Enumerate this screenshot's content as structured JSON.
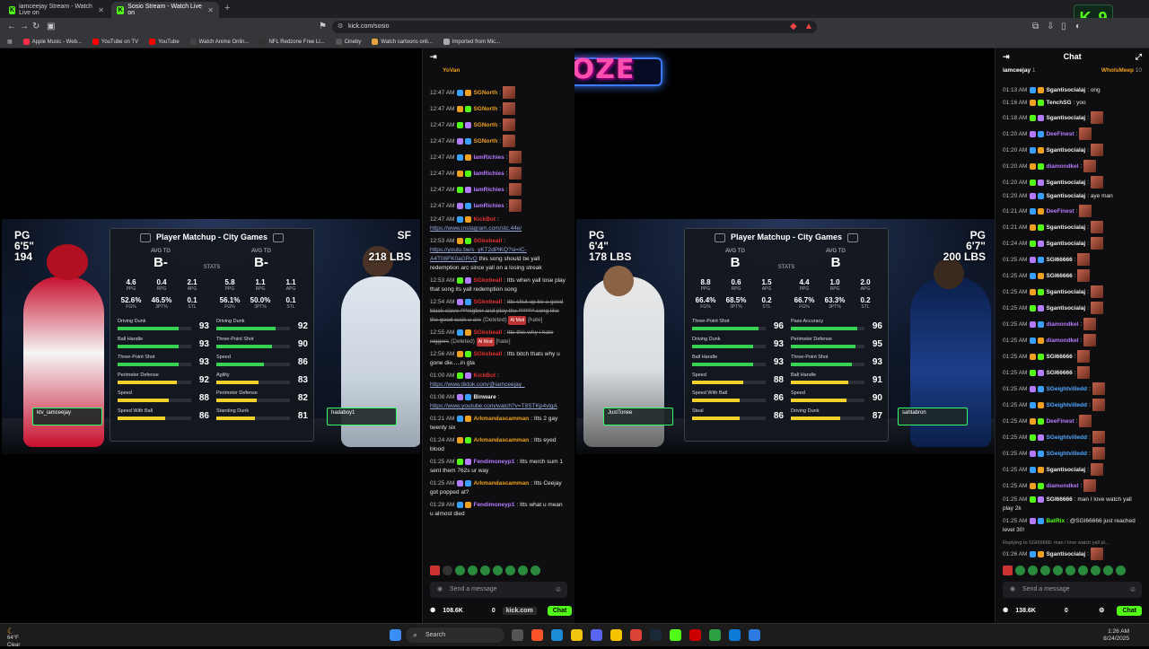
{
  "browser": {
    "tabs": [
      {
        "label": "iamceejay Stream - Watch Live on"
      },
      {
        "label": "Sosio Stream - Watch Live on"
      }
    ],
    "new_tab": "+",
    "url": "kick.com/sosio",
    "kick_badge": {
      "letter": "K",
      "count": "9"
    },
    "bookmarks": [
      {
        "label": "Apple Music - Web...",
        "color": "#fa2d48"
      },
      {
        "label": "YouTube on TV",
        "color": "#ff0000"
      },
      {
        "label": "YouTube",
        "color": "#ff0000"
      },
      {
        "label": "Watch Anime Onlin...",
        "color": "#444"
      },
      {
        "label": "NFL Redzone Free Li...",
        "color": "#333"
      },
      {
        "label": "Cineby",
        "color": "#555"
      },
      {
        "label": "Watch cartoons onli...",
        "color": "#e8a33b"
      },
      {
        "label": "Imported from Mic...",
        "color": "#aaa"
      }
    ]
  },
  "logo": {
    "text": "EXPOZE"
  },
  "left_game": {
    "left_pos": "PG",
    "left_height": "6'5\"",
    "left_weight": "194",
    "right_pos": "SF",
    "right_weight": "218 LBS",
    "card_title": "Player Matchup - City Games",
    "avg_label": "AVG TG",
    "left_grade": "B-",
    "right_grade": "B-",
    "stats_label": "STATS",
    "left_stats": [
      {
        "v": "4.6",
        "l": "PPG"
      },
      {
        "v": "0.4",
        "l": "RPG"
      },
      {
        "v": "2.1",
        "l": "APG"
      },
      {
        "v": "52.6%",
        "l": "FG%"
      },
      {
        "v": "46.5%",
        "l": "3PT%"
      },
      {
        "v": "0.1",
        "l": "STL"
      }
    ],
    "right_stats": [
      {
        "v": "5.8",
        "l": "PPG"
      },
      {
        "v": "1.1",
        "l": "RPG"
      },
      {
        "v": "1.1",
        "l": "APG"
      },
      {
        "v": "56.1%",
        "l": "FG%"
      },
      {
        "v": "50.0%",
        "l": "3PT%"
      },
      {
        "v": "0.1",
        "l": "STL"
      }
    ],
    "left_attrs": [
      {
        "n": "Driving Dunk",
        "v": "93"
      },
      {
        "n": "Ball Handle",
        "v": "93"
      },
      {
        "n": "Three-Point Shot",
        "v": "93"
      },
      {
        "n": "Perimeter Defense",
        "v": "92"
      },
      {
        "n": "Speed",
        "v": "88"
      },
      {
        "n": "Speed With Ball",
        "v": "86"
      }
    ],
    "right_attrs": [
      {
        "n": "Driving Dunk",
        "v": "92"
      },
      {
        "n": "Three-Point Shot",
        "v": "90"
      },
      {
        "n": "Speed",
        "v": "86"
      },
      {
        "n": "Agility",
        "v": "83"
      },
      {
        "n": "Perimeter Defense",
        "v": "82"
      },
      {
        "n": "Standing Dunk",
        "v": "81"
      }
    ],
    "left_tag": "ktv_iamceejay",
    "right_tag": "hadaboy1"
  },
  "right_game": {
    "left_pos": "PG",
    "left_height": "6'4\"",
    "left_weight": "178 LBS",
    "right_pos": "PG",
    "right_height": "6'7\"",
    "right_weight": "200 LBS",
    "card_title": "Player Matchup - City Games",
    "avg_label": "AVG TG",
    "left_grade": "B",
    "right_grade": "B",
    "stats_label": "STATS",
    "left_stats": [
      {
        "v": "8.8",
        "l": "PPG"
      },
      {
        "v": "0.6",
        "l": "RPG"
      },
      {
        "v": "1.5",
        "l": "APG"
      },
      {
        "v": "66.4%",
        "l": "FG%"
      },
      {
        "v": "68.5%",
        "l": "3PT%"
      },
      {
        "v": "0.2",
        "l": "STL"
      }
    ],
    "right_stats": [
      {
        "v": "4.4",
        "l": "PPG"
      },
      {
        "v": "1.0",
        "l": "RPG"
      },
      {
        "v": "2.0",
        "l": "APG"
      },
      {
        "v": "66.7%",
        "l": "FG%"
      },
      {
        "v": "63.3%",
        "l": "3PT%"
      },
      {
        "v": "0.2",
        "l": "STL"
      }
    ],
    "left_attrs": [
      {
        "n": "Three-Point Shot",
        "v": "96"
      },
      {
        "n": "Driving Dunk",
        "v": "93"
      },
      {
        "n": "Ball Handle",
        "v": "93"
      },
      {
        "n": "Speed",
        "v": "88"
      },
      {
        "n": "Speed With Ball",
        "v": "86"
      },
      {
        "n": "Steal",
        "v": "86"
      }
    ],
    "right_attrs": [
      {
        "n": "Pass Accuracy",
        "v": "96"
      },
      {
        "n": "Perimeter Defense",
        "v": "95"
      },
      {
        "n": "Three-Point Shot",
        "v": "93"
      },
      {
        "n": "Ball Handle",
        "v": "91"
      },
      {
        "n": "Speed",
        "v": "90"
      },
      {
        "n": "Driving Dunk",
        "v": "87"
      }
    ],
    "left_tag": "JustTonee",
    "right_tag": "sahtabron"
  },
  "chat1": {
    "pinned_user": "YoVan",
    "messages": [
      {
        "t": "12:47 AM",
        "u": "SGNorth",
        "c": "#f0a020",
        "m": "",
        "emote": true
      },
      {
        "t": "12:47 AM",
        "u": "SGNorth",
        "c": "#f0a020",
        "m": "",
        "emote": true
      },
      {
        "t": "12:47 AM",
        "u": "SGNorth",
        "c": "#f0a020",
        "m": "",
        "emote": true
      },
      {
        "t": "12:47 AM",
        "u": "SGNorth",
        "c": "#f0a020",
        "m": "",
        "emote": true
      },
      {
        "t": "12:47 AM",
        "u": "IamRichies",
        "c": "#b57bff",
        "m": "",
        "emote": true
      },
      {
        "t": "12:47 AM",
        "u": "IamRichies",
        "c": "#b57bff",
        "m": "",
        "emote": true
      },
      {
        "t": "12:47 AM",
        "u": "IamRichies",
        "c": "#b57bff",
        "m": "",
        "emote": true
      },
      {
        "t": "12:47 AM",
        "u": "IamRichies",
        "c": "#b57bff",
        "m": "",
        "emote": true
      },
      {
        "t": "12:47 AM",
        "u": "KickBot",
        "c": "#e03030",
        "m": "",
        "link": "https://www.instagram.com/stc.44e/"
      },
      {
        "t": "12:53 AM",
        "u": "SGkobeall",
        "c": "#e03030",
        "m": "this song should be yall redemption arc since yall on a losing streak",
        "link": "https://youtu.be/s_yKT2dPlKQ?si=IC-A4T08FK0aGRvQ"
      },
      {
        "t": "12:53 AM",
        "u": "SGkobeall",
        "c": "#e03030",
        "m": "Itts when yall lose play that song its yall redemption song"
      },
      {
        "t": "12:54 AM",
        "u": "SGkobeall",
        "c": "#e03030",
        "del": "Itts shut up be a good black slave ***nigber and play the ******* song like the good cuck u are",
        "note": "(Deleted)",
        "pill": "AI Mod",
        "tail": "[hate]"
      },
      {
        "t": "12:55 AM",
        "u": "SGkobeall",
        "c": "#e03030",
        "del": "Itts this why i hate niggers",
        "note": "(Deleted)",
        "pill": "AI Mod",
        "tail": "[hate]"
      },
      {
        "t": "12:56 AM",
        "u": "SGkobeall",
        "c": "#e03030",
        "m": "Itts bitch thats why u gone die.....in gta"
      },
      {
        "t": "01:00 AM",
        "u": "KickBot",
        "c": "#e03030",
        "m": "",
        "link": "https://www.tiktok.com/@iamceejay_"
      },
      {
        "t": "01:08 AM",
        "u": "Binware",
        "c": "#f0f0f0",
        "m": "",
        "link": "https://www.youtube.com/watch?v=T8STKp4vlgA"
      },
      {
        "t": "01:21 AM",
        "u": "Arkmandascamman",
        "c": "#f0a020",
        "m": "Itts 2 gay twenty six"
      },
      {
        "t": "01:24 AM",
        "u": "Arkmandascamman",
        "c": "#f0a020",
        "m": "Itts eyed blood"
      },
      {
        "t": "01:25 AM",
        "u": "Fendimoneyp1",
        "c": "#b57bff",
        "m": "Itts merch sum 1 sent them 762s ur way"
      },
      {
        "t": "01:25 AM",
        "u": "Arkmandascamman",
        "c": "#f0a020",
        "m": "Itts Ceejay got popped at?"
      },
      {
        "t": "01:28 AM",
        "u": "Fendimoneyp1",
        "c": "#b57bff",
        "m": "Itts what u mean u almost died"
      }
    ],
    "send_placeholder": "Send a message",
    "viewers": "108.6K",
    "count": "0",
    "chat_btn": "Chat",
    "mini_tab": "kick.com"
  },
  "chat2": {
    "title": "Chat",
    "pinned_left": "iamceejay",
    "pinned_left_count": "1",
    "pinned_right": "WhoIsMeep",
    "pinned_right_count": "10",
    "messages": [
      {
        "t": "01:13 AM",
        "u": "Sgantisocialaj",
        "c": "#f0f0f0",
        "m": "ong"
      },
      {
        "t": "01:16 AM",
        "u": "TenchSG",
        "c": "#f0f0f0",
        "m": "yoo"
      },
      {
        "t": "01:18 AM",
        "u": "Sgantisocialaj",
        "c": "#f0f0f0",
        "m": "",
        "emote": true
      },
      {
        "t": "01:20 AM",
        "u": "DeeFinest",
        "c": "#b57bff",
        "m": "",
        "emote": true
      },
      {
        "t": "01:20 AM",
        "u": "Sgantisocialaj",
        "c": "#f0f0f0",
        "m": "",
        "emote": true
      },
      {
        "t": "01:20 AM",
        "u": "diamondkel",
        "c": "#b57bff",
        "m": "",
        "emote": true
      },
      {
        "t": "01:20 AM",
        "u": "Sgantisocialaj",
        "c": "#f0f0f0",
        "m": "",
        "emote": true
      },
      {
        "t": "01:20 AM",
        "u": "Sgantisocialaj",
        "c": "#f0f0f0",
        "m": "aye man"
      },
      {
        "t": "01:21 AM",
        "u": "DeeFinest",
        "c": "#b57bff",
        "m": "",
        "emote": true
      },
      {
        "t": "01:21 AM",
        "u": "Sgantisocialaj",
        "c": "#f0f0f0",
        "m": "",
        "emote": true
      },
      {
        "t": "01:24 AM",
        "u": "Sgantisocialaj",
        "c": "#f0f0f0",
        "m": "",
        "emote": true
      },
      {
        "t": "01:25 AM",
        "u": "SGI66666",
        "c": "#f0f0f0",
        "m": "",
        "emote": true
      },
      {
        "t": "01:25 AM",
        "u": "SGI66666",
        "c": "#f0f0f0",
        "m": "",
        "emote": true
      },
      {
        "t": "01:25 AM",
        "u": "Sgantisocialaj",
        "c": "#f0f0f0",
        "m": "",
        "emote": true
      },
      {
        "t": "01:25 AM",
        "u": "Sgantisocialaj",
        "c": "#f0f0f0",
        "m": "",
        "emote": true
      },
      {
        "t": "01:25 AM",
        "u": "diamondkel",
        "c": "#b57bff",
        "m": "",
        "emote": true
      },
      {
        "t": "01:25 AM",
        "u": "diamondkel",
        "c": "#b57bff",
        "m": "",
        "emote": true
      },
      {
        "t": "01:25 AM",
        "u": "SGI66666",
        "c": "#f0f0f0",
        "m": "",
        "emote": true
      },
      {
        "t": "01:25 AM",
        "u": "SGI66666",
        "c": "#f0f0f0",
        "m": "",
        "emote": true
      },
      {
        "t": "01:25 AM",
        "u": "SGeightvilledd",
        "c": "#4fa8ff",
        "m": "",
        "emote": true
      },
      {
        "t": "01:25 AM",
        "u": "SGeightvilledd",
        "c": "#4fa8ff",
        "m": "",
        "emote": true
      },
      {
        "t": "01:25 AM",
        "u": "DeeFinest",
        "c": "#b57bff",
        "m": "",
        "emote": true
      },
      {
        "t": "01:25 AM",
        "u": "SGeightvilledd",
        "c": "#4fa8ff",
        "m": "",
        "emote": true
      },
      {
        "t": "01:25 AM",
        "u": "SGeightvilledd",
        "c": "#4fa8ff",
        "m": "",
        "emote": true
      },
      {
        "t": "01:25 AM",
        "u": "Sgantisocialaj",
        "c": "#f0f0f0",
        "m": "",
        "emote": true
      },
      {
        "t": "01:25 AM",
        "u": "diamondkel",
        "c": "#b57bff",
        "m": "",
        "emote": true
      },
      {
        "t": "01:25 AM",
        "u": "SGI66666",
        "c": "#f0f0f0",
        "m": "man I love watch yall play 2k"
      },
      {
        "t": "01:25 AM",
        "u": "BatRix",
        "c": "#53fc18",
        "m": "@SGI66666 just reached level 30!"
      },
      {
        "t": "01:26 AM",
        "u": "Sgantisocialaj",
        "c": "#f0f0f0",
        "m": "",
        "emote": true,
        "reply": "Replying to SGI66666: man I love watch yall pl..."
      }
    ],
    "send_placeholder": "Send a message",
    "viewers": "138.6K",
    "count": "0",
    "chat_btn": "Chat"
  },
  "taskbar": {
    "weather_temp": "64°F",
    "weather_desc": "Clear",
    "search": "Search",
    "time": "1:26 AM",
    "date": "8/24/2025"
  }
}
